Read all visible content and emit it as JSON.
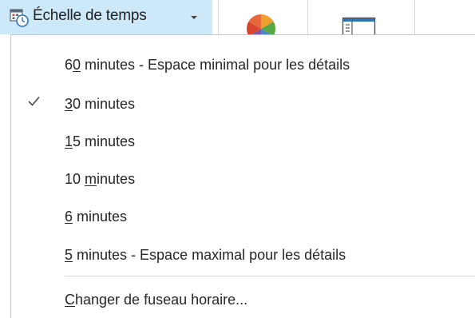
{
  "ribbon": {
    "timescale_button": {
      "label": "Échelle de temps",
      "icon": "calendar-clock-icon",
      "background": "#cde8f8"
    },
    "color_categories_icon": "pie-chart-icon",
    "view_layout_icon": "window-layout-icon"
  },
  "menu": {
    "items": [
      {
        "pre": "6",
        "key": "0",
        "post": " minutes - Espace minimal pour les détails",
        "checked": false
      },
      {
        "pre": "",
        "key": "3",
        "post": "0 minutes",
        "checked": true
      },
      {
        "pre": "",
        "key": "1",
        "post": "5 minutes",
        "checked": false
      },
      {
        "pre": "10 ",
        "key": "m",
        "post": "inutes",
        "checked": false
      },
      {
        "pre": "",
        "key": "6",
        "post": " minutes",
        "checked": false
      },
      {
        "pre": "",
        "key": "5",
        "post": " minutes - Espace maximal pour les détails",
        "checked": false
      }
    ],
    "footer_item": {
      "pre": "",
      "key": "C",
      "post": "hanger de fuseau horaire..."
    }
  }
}
